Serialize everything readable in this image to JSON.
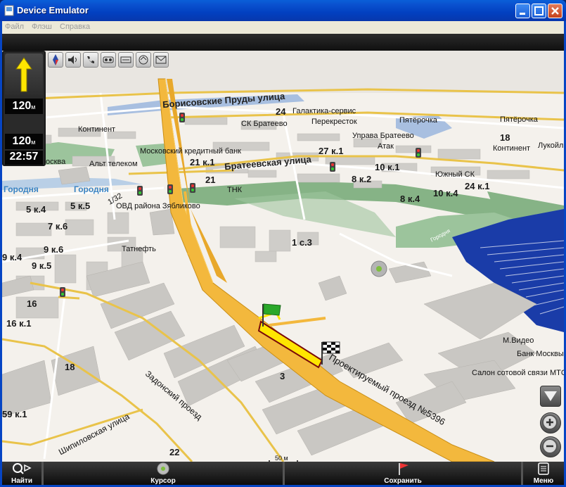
{
  "window": {
    "title": "Device Emulator",
    "menu": [
      "Файл",
      "Флэш",
      "Справка"
    ]
  },
  "hud": {
    "distance_to_turn": "120",
    "distance_unit": "м",
    "remaining_distance": "120",
    "remaining_unit": "м",
    "arrival_time": "22:57",
    "toolbar_icons": [
      "compass-icon",
      "volume-icon",
      "phone-icon",
      "traffic-icon",
      "route-icon",
      "gps-icon",
      "mail-icon"
    ]
  },
  "map": {
    "streets": [
      "Борисовские Пруды улица",
      "Братеевская улица",
      "Задонский проезд",
      "Шипиловская улица",
      "Проектируемый проезд №5396"
    ],
    "districts": [
      "Городня",
      "Городня"
    ],
    "water_label": "Городня",
    "pois": [
      "Галактика-сервис",
      "Перекресток",
      "СК Братеево",
      "Пятёрочка",
      "Управа Братеево",
      "Атак",
      "Московский кредитный банк",
      "Континент",
      "Альт телеком",
      "ТНК",
      "ОВД района Зябликово",
      "Южный СК",
      "Пятёрочка",
      "Континент",
      "Лукойл",
      "Татнефть",
      "М.Видео",
      "Банк Москвы",
      "Салон сотовой связи МТС",
      "осква"
    ],
    "house_numbers": [
      "24",
      "27 к.1",
      "21 к.1",
      "21",
      "10 к.1",
      "8 к.2",
      "8 к.4",
      "10 к.4",
      "24 к.1",
      "18",
      "5 к.4",
      "5 к.5",
      "7 к.6",
      "9 к.6",
      "9 к.4",
      "9 к.5",
      "1 с.3",
      "16",
      "16 к.1",
      "18",
      "3",
      "59 к.1",
      "22",
      "1/32"
    ],
    "scale": "50 м"
  },
  "bottom": {
    "find": "Найти",
    "cursor": "Курсор",
    "save": "Сохранить",
    "menu": "Меню"
  }
}
